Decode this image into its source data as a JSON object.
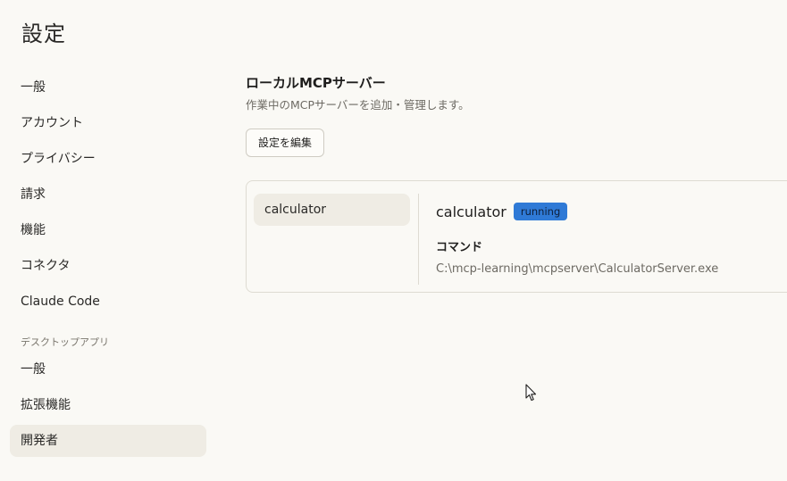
{
  "page": {
    "title": "設定"
  },
  "sidebar": {
    "items": [
      {
        "label": "一般"
      },
      {
        "label": "アカウント"
      },
      {
        "label": "プライバシー"
      },
      {
        "label": "請求"
      },
      {
        "label": "機能"
      },
      {
        "label": "コネクタ"
      },
      {
        "label": "Claude Code"
      }
    ],
    "desktop_section": {
      "heading": "デスクトップアプリ",
      "items": [
        {
          "label": "一般"
        },
        {
          "label": "拡張機能"
        },
        {
          "label": "開発者",
          "active": true
        }
      ]
    }
  },
  "main": {
    "section_title": "ローカルMCPサーバー",
    "section_desc": "作業中のMCPサーバーを追加・管理します。",
    "edit_button": "設定を編集",
    "servers": [
      {
        "name": "calculator"
      }
    ],
    "selected_server": {
      "name": "calculator",
      "status": "running",
      "command_label": "コマンド",
      "command": "C:\\mcp-learning\\mcpserver\\CalculatorServer.exe"
    }
  },
  "colors": {
    "background": "#faf9f5",
    "active_item": "#efece4",
    "status_running": "#2f7ad6"
  },
  "icons": {
    "cursor": "mouse-pointer-icon"
  }
}
